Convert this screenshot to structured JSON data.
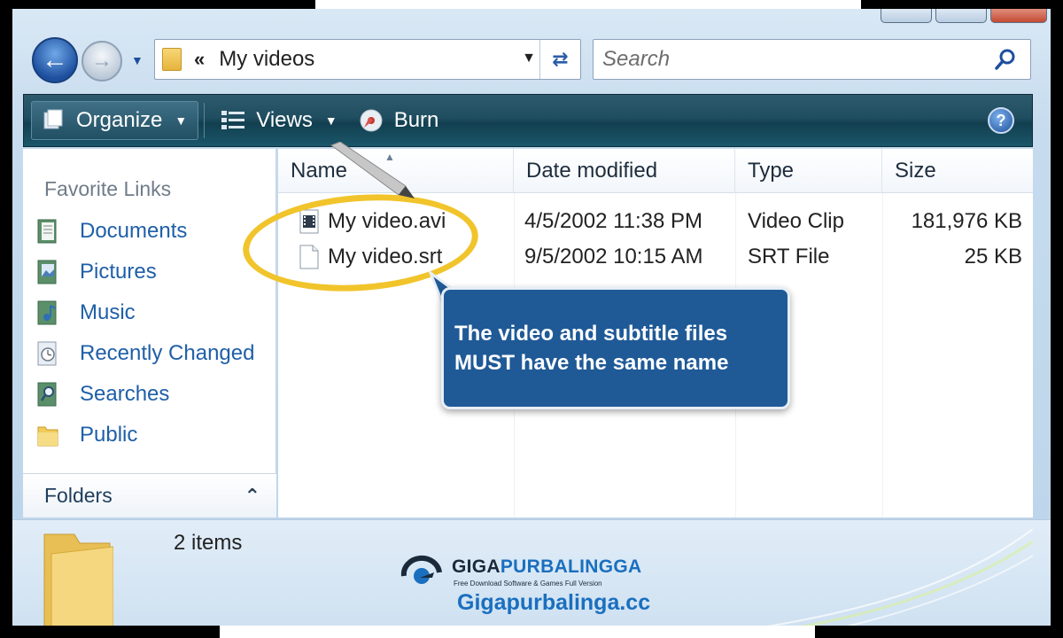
{
  "window": {
    "address": {
      "chevron": "«",
      "path": "My videos"
    },
    "search": {
      "placeholder": "Search"
    }
  },
  "toolbar": {
    "organize_label": "Organize",
    "views_label": "Views",
    "burn_label": "Burn",
    "help_label": "?"
  },
  "navigation": {
    "favorites_title": "Favorite Links",
    "items": [
      {
        "label": "Documents"
      },
      {
        "label": "Pictures"
      },
      {
        "label": "Music"
      },
      {
        "label": "Recently Changed"
      },
      {
        "label": "Searches"
      },
      {
        "label": "Public"
      }
    ],
    "folders_label": "Folders"
  },
  "filelist": {
    "columns": [
      "Name",
      "Date modified",
      "Type",
      "Size"
    ],
    "rows": [
      {
        "name": "My video.avi",
        "date": "4/5/2002 11:38 PM",
        "type": "Video Clip",
        "size": "181,976 KB"
      },
      {
        "name": "My video.srt",
        "date": "9/5/2002 10:15 AM",
        "type": "SRT File",
        "size": "25 KB"
      }
    ]
  },
  "callout": {
    "line1": "The video and subtitle files",
    "line2": "MUST have the same name"
  },
  "details": {
    "items_count": "2 items"
  },
  "watermark": {
    "brand_part1": "GIGA",
    "brand_part2": "PURBALINGGA",
    "tagline": "Free Download Software & Games Full Version",
    "url": "Gigapurbalinga.cc"
  },
  "colors": {
    "accent_link": "#1f5fa8",
    "toolbar_bg": "#1f4e60",
    "callout_bg": "#1f5a97",
    "highlight_circle": "#f1c42c"
  }
}
